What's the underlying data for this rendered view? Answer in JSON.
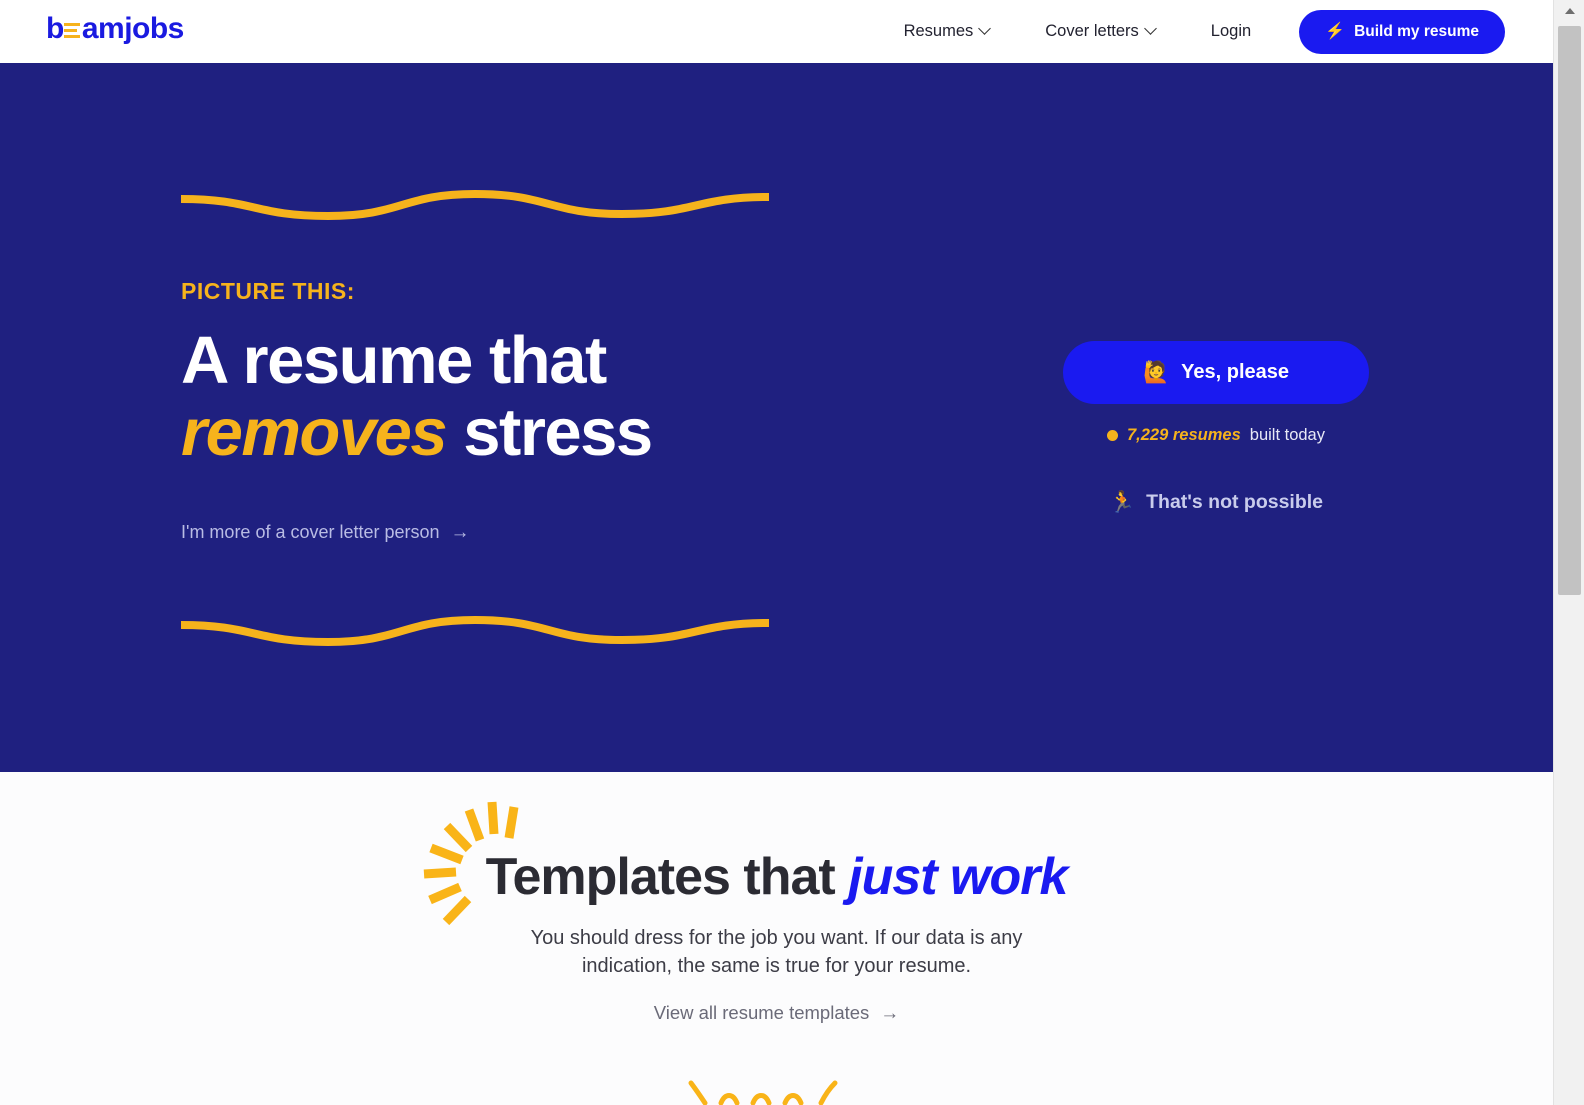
{
  "brand": {
    "name": "beamjobs",
    "name_prefix": "b",
    "name_suffix": "amjobs",
    "beam_icon": "beam-icon",
    "logo_color": "#1A1AE0",
    "beam_color": "#F6B31C"
  },
  "colors": {
    "hero_bg": "#1F2080",
    "accent_yellow": "#F6B31C",
    "accent_blue": "#1A1AF0",
    "page_bg": "#FCFCFD",
    "dark_text": "#2B2B33"
  },
  "nav": {
    "items": [
      {
        "label": "Resumes",
        "has_dropdown": true
      },
      {
        "label": "Cover letters",
        "has_dropdown": true
      },
      {
        "label": "Login",
        "has_dropdown": false
      }
    ],
    "cta": {
      "label": "Build my resume",
      "icon": "lightning-bolt-icon",
      "icon_glyph": "⚡"
    }
  },
  "hero": {
    "eyebrow": "PICTURE THIS:",
    "headline_line1": "A resume that",
    "headline_accent": "removes",
    "headline_line2_rest": "stress",
    "cover_letter_link": "I'm more of a cover letter person",
    "cover_letter_arrow": "→",
    "cta": {
      "label": "Yes, please",
      "icon": "raising-hand-emoji",
      "icon_glyph": "🙋"
    },
    "stat": {
      "bullet": "yellow-dot-icon",
      "count": "7,229 resumes",
      "suffix": "built today"
    },
    "secondary": {
      "label": "That's not possible",
      "icon": "running-person-emoji",
      "icon_glyph": "🏃"
    },
    "decoration_top": "wavy-line-decoration",
    "decoration_bottom": "wavy-line-decoration"
  },
  "templates": {
    "title_main": "Templates that",
    "title_accent": "just work",
    "subtitle_line1": "You should dress for the job you want. If our data is any",
    "subtitle_line2": "indication, the same is true for your resume.",
    "link": "View all resume templates",
    "link_arrow": "→",
    "decoration": "sunburst-rays-decoration"
  },
  "scrollbar": {
    "up_arrow": "scroll-up-arrow-icon",
    "thumb": "scrollbar-thumb"
  }
}
